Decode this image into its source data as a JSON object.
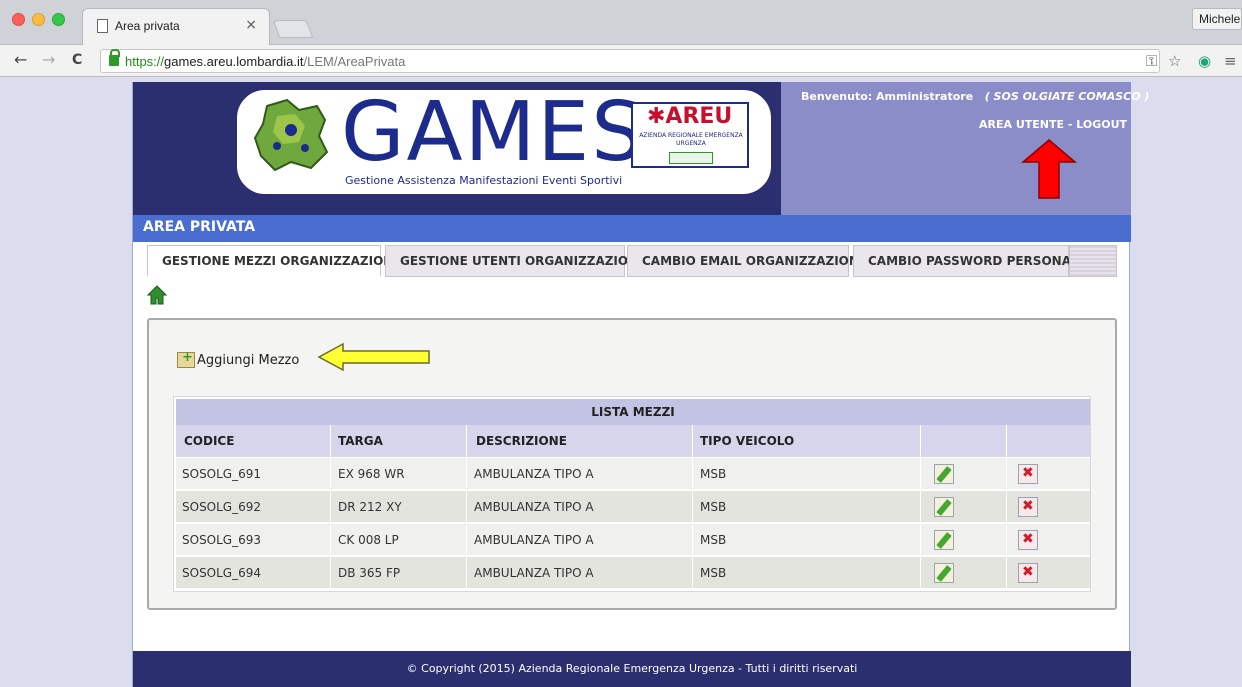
{
  "browser": {
    "tab_title": "Area privata",
    "tab_close": "×",
    "profile_label": "Michele",
    "back": "←",
    "forward": "→",
    "reload": "C",
    "url_scheme": "https://",
    "url_host": "games.areu.lombardia.it",
    "url_path": "/LEM/AreaPrivata",
    "key_icon": "⚿",
    "star_icon": "☆",
    "ext_icon": "◉",
    "menu_icon": "≡"
  },
  "header": {
    "welcome_label": "Benvenuto: Amministratore",
    "organization": "( SOS OLGIATE COMASCO )",
    "user_links": "AREA UTENTE - LOGOUT",
    "logo": {
      "wordmark": "GAMES",
      "subtitle": "Gestione Assistenza Manifestazioni Eventi Sportivi",
      "areu_title": "✱AREU",
      "areu_subtitle": "AZIENDA REGIONALE EMERGENZA URGENZA",
      "region": "Regione Lombardia"
    }
  },
  "area_title": "AREA PRIVATA",
  "tabs": [
    {
      "label": "GESTIONE MEZZI ORGANIZZAZIONE",
      "active": true
    },
    {
      "label": "GESTIONE UTENTI ORGANIZZAZIONE",
      "active": false
    },
    {
      "label": "CAMBIO EMAIL ORGANIZZAZIONE",
      "active": false
    },
    {
      "label": "CAMBIO PASSWORD PERSONALE",
      "active": false
    }
  ],
  "add_vehicle_label": "Aggiungi Mezzo",
  "list": {
    "title": "LISTA MEZZI",
    "columns": [
      "CODICE",
      "TARGA",
      "DESCRIZIONE",
      "TIPO VEICOLO"
    ],
    "rows": [
      {
        "codice": "SOSOLG_691",
        "targa": "EX 968 WR",
        "descrizione": "AMBULANZA TIPO A",
        "tipo": "MSB"
      },
      {
        "codice": "SOSOLG_692",
        "targa": "DR 212 XY",
        "descrizione": "AMBULANZA TIPO A",
        "tipo": "MSB"
      },
      {
        "codice": "SOSOLG_693",
        "targa": "CK 008 LP",
        "descrizione": "AMBULANZA TIPO A",
        "tipo": "MSB"
      },
      {
        "codice": "SOSOLG_694",
        "targa": "DB 365 FP",
        "descrizione": "AMBULANZA TIPO A",
        "tipo": "MSB"
      }
    ]
  },
  "footer_text": "© Copyright (2015) Azienda Regionale Emergenza Urgenza - Tutti i diritti riservati",
  "colors": {
    "header_dark": "#2b2f6f",
    "header_light": "#8b8dc9",
    "area_bar": "#4a6ed0",
    "red_arrow": "#ff0000",
    "yellow_arrow": "#ffff33"
  },
  "icons": [
    "home-icon",
    "add-vehicle-icon",
    "edit-icon",
    "delete-icon",
    "lock-icon"
  ]
}
